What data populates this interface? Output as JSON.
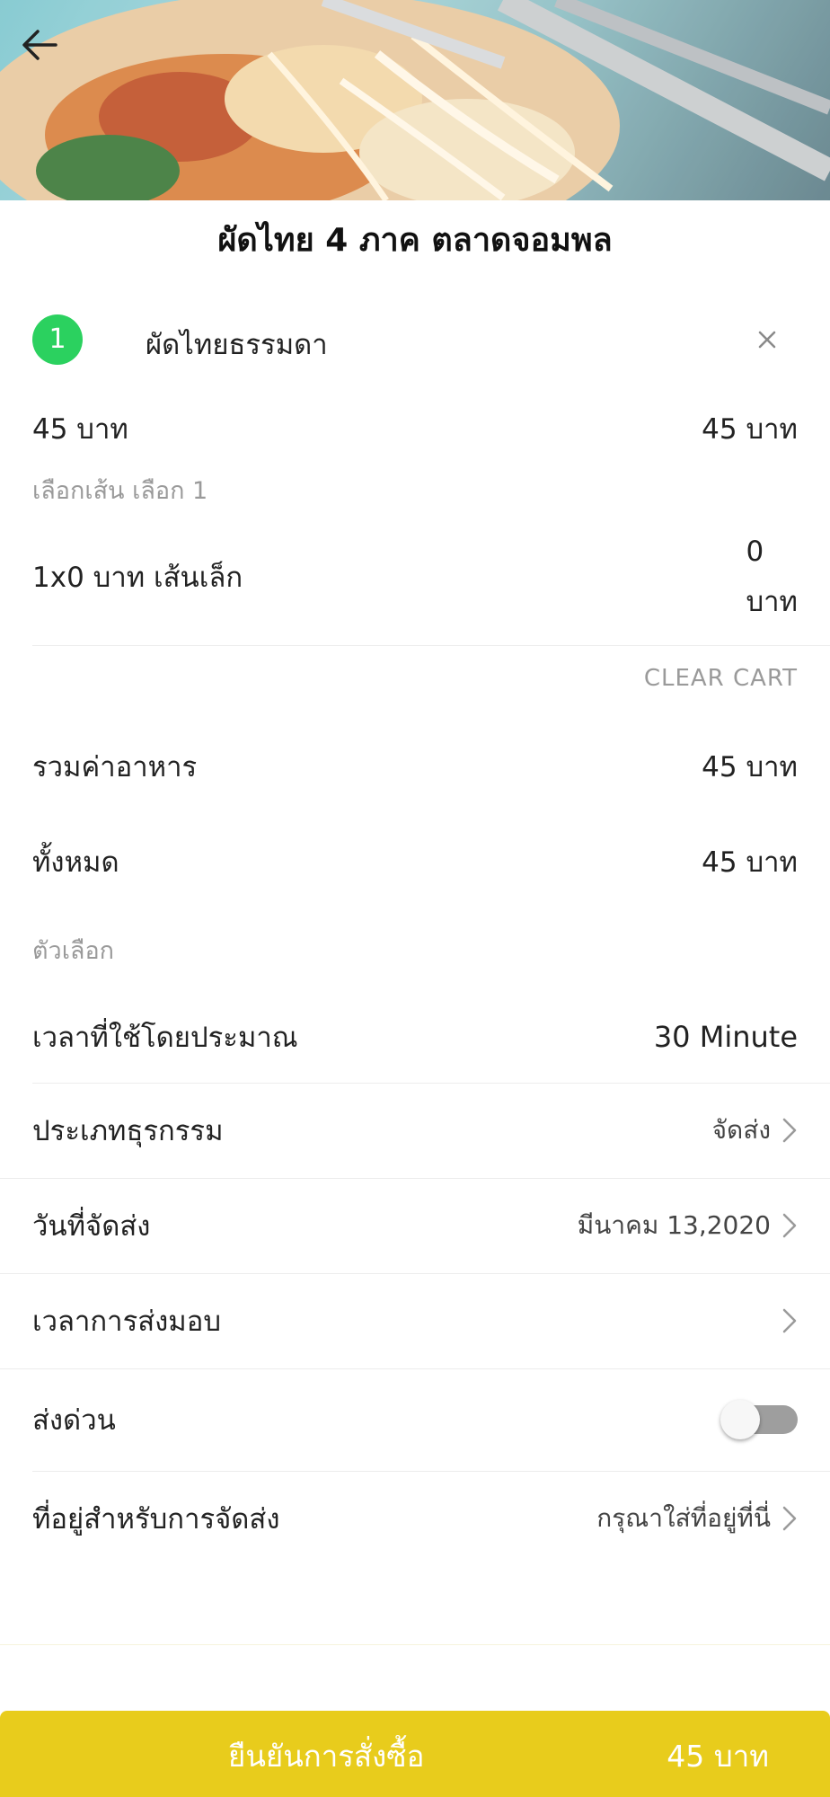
{
  "header": {
    "shop_name": "ผัดไทย 4 ภาค ตลาดจอมพล"
  },
  "cart": {
    "item": {
      "quantity": "1",
      "name": "ผัดไทยธรรมดา",
      "unit_price": "45 บาท",
      "line_total": "45 บาท"
    },
    "option_group": "เลือกเส้น เลือก 1",
    "option": {
      "label": "1x0 บาท  เส้นเล็ก",
      "price_value": "0",
      "price_unit": "บาท"
    },
    "clear_cart_label": "CLEAR CART"
  },
  "summary": {
    "food_total_label": "รวมค่าอาหาร",
    "food_total_value": "45 บาท",
    "grand_total_label": "ทั้งหมด",
    "grand_total_value": "45 บาท"
  },
  "options": {
    "section_label": "ตัวเลือก",
    "est_time_label": "เวลาที่ใช้โดยประมาณ",
    "est_time_value": "30 Minute",
    "business_type_label": "ประเภทธุรกรรม",
    "business_type_value": "จัดส่ง",
    "delivery_date_label": "วันที่จัดส่ง",
    "delivery_date_value": "มีนาคม 13,2020",
    "delivery_time_label": "เวลาการส่งมอบ",
    "express_label": "ส่งด่วน",
    "express_on": false,
    "address_label": "ที่อยู่สำหรับการจัดส่ง",
    "address_value": "กรุณาใส่ที่อยู่ที่นี่"
  },
  "footer": {
    "confirm_label": "ยืนยันการสั่งซื้อ",
    "confirm_total": "45 บาท"
  },
  "colors": {
    "accent_yellow": "#e8cc1c",
    "badge_green": "#2bd15f"
  }
}
